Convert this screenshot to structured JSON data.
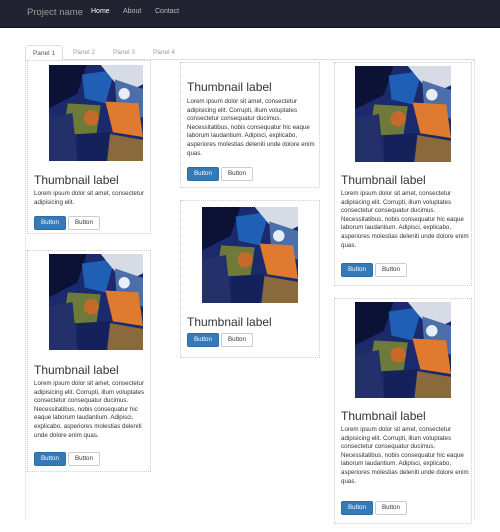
{
  "navbar": {
    "brand": "Project name",
    "links": [
      "Home",
      "About",
      "Contact"
    ]
  },
  "tabs": [
    "Panel 1",
    "Panel 2",
    "Panel 3",
    "Panel 4"
  ],
  "card": {
    "label": "Thumbnail label",
    "short_text": "Lorem ipsum dolor sit amet, consectetur adipisicing elit.",
    "long_text": "Lorem ipsum dolor sit amet, consectetur adipisicing elit. Corrupti, illum voluptates consectetur consequatur ducimus. Necessitatibus, nobis consequatur hic eaque laborum laudantium. Adipisci, explicabo, asperiores molestias deleniti unde dolore enim quas.",
    "primary_button": "Button",
    "secondary_button": "Button"
  },
  "colors": {
    "navbar_bg": "#222230",
    "primary": "#337ab7",
    "thumb_dark": "#1a2a6c",
    "thumb_orange": "#e07a2f"
  }
}
